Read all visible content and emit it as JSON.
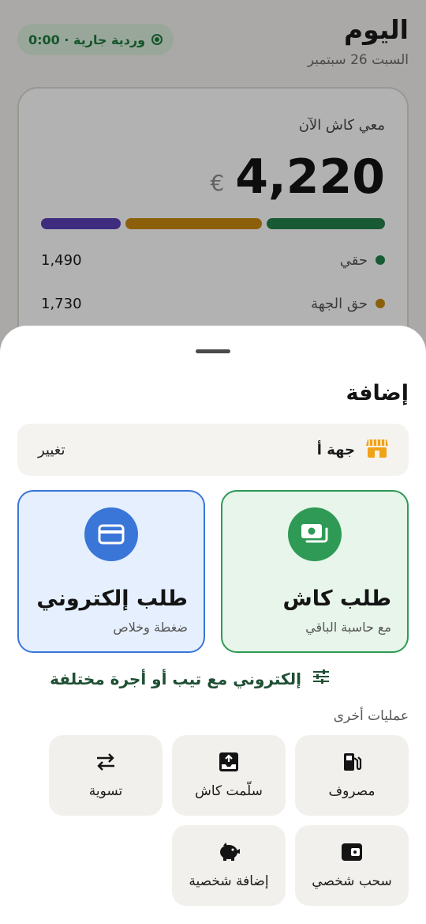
{
  "header": {
    "title": "اليوم",
    "date": "السبت 26 سبتمبر",
    "shift_badge": "وردية جارية · 0:00"
  },
  "cash_card": {
    "label": "معي كاش الآن",
    "amount": "4,220",
    "currency_symbol": "€",
    "bar_colors": [
      "#23814a",
      "#c9880f",
      "#5a3fb6"
    ],
    "breakdown": [
      {
        "label": "حقي",
        "value": "1,490",
        "dot_color": "#23814a"
      },
      {
        "label": "حق الجهة",
        "value": "1,730",
        "dot_color": "#c9880f"
      }
    ]
  },
  "sheet": {
    "title": "إضافة",
    "entity": {
      "name": "جهة أ",
      "change_label": "تغيير",
      "icon": "store-icon"
    },
    "cash_request": {
      "title": "طلب كاش",
      "subtitle": "مع حاسبة الباقي",
      "icon": "cash-icon",
      "accent": "#2e9a55"
    },
    "card_request": {
      "title": "طلب إلكتروني",
      "subtitle": "ضغطة وخلاص",
      "icon": "card-icon",
      "accent": "#3a76d8"
    },
    "tips_link": {
      "label": "إلكتروني مع تيب أو أجرة مختلفة",
      "icon": "sliders-icon"
    },
    "other_ops_label": "عمليات أخرى",
    "operations": [
      {
        "label": "مصروف",
        "icon": "fuel-icon"
      },
      {
        "label": "سلّمت كاش",
        "icon": "inbox-upload-icon"
      },
      {
        "label": "تسوية",
        "icon": "swap-icon"
      },
      {
        "label": "سحب شخصي",
        "icon": "wallet-icon"
      },
      {
        "label": "إضافة شخصية",
        "icon": "piggy-bank-icon"
      }
    ]
  }
}
